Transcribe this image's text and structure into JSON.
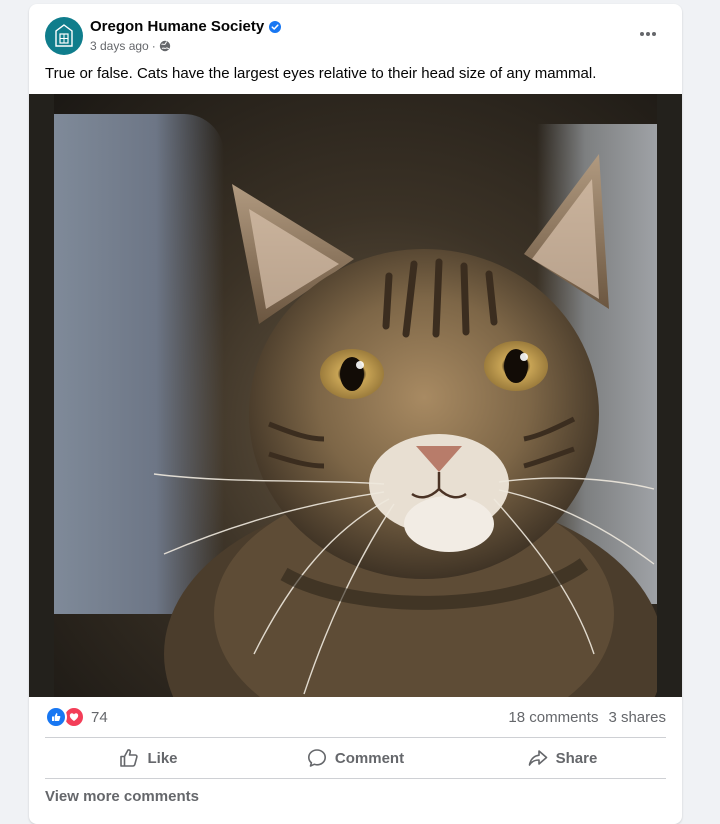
{
  "post": {
    "page_name": "Oregon Humane Society",
    "timestamp": "3 days ago",
    "meta_separator": "·",
    "text": "True or false. Cats have the largest eyes relative to their head size of any mammal.",
    "photo_icon": "tabby-cat-photo"
  },
  "engagement": {
    "reaction_count": "74",
    "comments": "18 comments",
    "shares": "3 shares"
  },
  "actions": {
    "like": "Like",
    "comment": "Comment",
    "share": "Share"
  },
  "comments_link": "View more comments",
  "colors": {
    "brand_teal": "#0f7d8c",
    "like_blue": "#1877f2",
    "love_red": "#f33e58",
    "secondary_text": "#65676b"
  }
}
